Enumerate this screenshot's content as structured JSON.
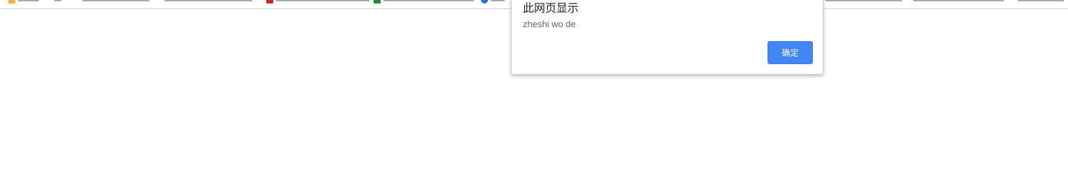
{
  "dialog": {
    "title": "此网页显示",
    "message": "zheshi wo de",
    "ok_label": "确定"
  },
  "colors": {
    "ok_button": "#4285f4",
    "background": "#ffffff"
  },
  "bookmarks": {
    "icons": [
      "folder-icon",
      "bookmark-icon",
      "bookmark-icon",
      "red-bookmark-icon",
      "bookmark-icon",
      "green-bookmark-icon",
      "globe-icon",
      "bookmark-icon",
      "bookmark-icon",
      "bookmark-icon"
    ]
  }
}
